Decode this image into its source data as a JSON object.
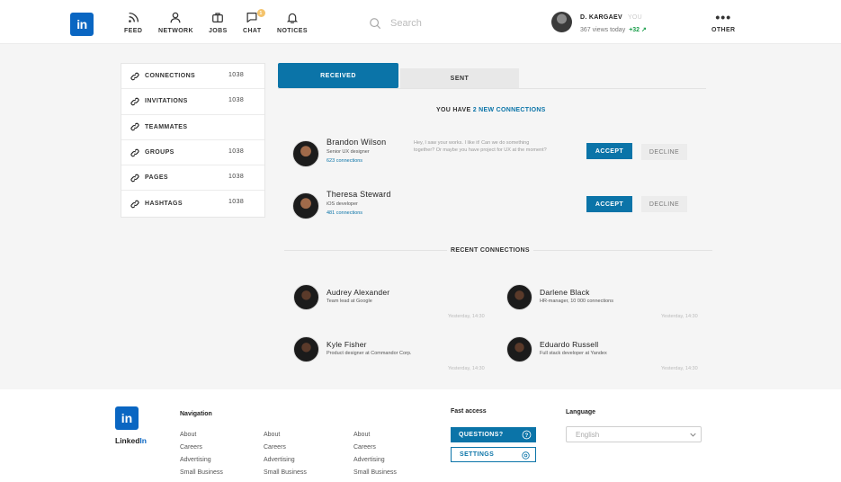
{
  "header": {
    "logo": "in",
    "nav": [
      {
        "label": "FEED",
        "icon": "rss-icon"
      },
      {
        "label": "NETWORK",
        "icon": "user-icon"
      },
      {
        "label": "JOBS",
        "icon": "briefcase-icon"
      },
      {
        "label": "CHAT",
        "icon": "chat-icon",
        "badge": "1"
      },
      {
        "label": "NOTICES",
        "icon": "bell-icon"
      }
    ],
    "search_placeholder": "Search",
    "user": {
      "name": "D. KARGAEV",
      "you": "YOU",
      "views": "367 views today",
      "delta": "+32 ↗"
    },
    "other_label": "OTHER"
  },
  "sidebar": {
    "items": [
      {
        "label": "CONNECTIONS",
        "count": "1038"
      },
      {
        "label": "INVITATIONS",
        "count": "1038"
      },
      {
        "label": "TEAMMATES",
        "count": ""
      },
      {
        "label": "GROUPS",
        "count": "1038"
      },
      {
        "label": "PAGES",
        "count": "1038"
      },
      {
        "label": "HASHTAGS",
        "count": "1038"
      }
    ]
  },
  "tabs": {
    "received": "RECEIVED",
    "sent": "SENT"
  },
  "new_connections": {
    "prefix": "YOU HAVE",
    "highlight": "2 NEW CONNECTIONS"
  },
  "requests": [
    {
      "name": "Brandon Wilson",
      "role": "Senior UX designer",
      "connections": "623 connections",
      "message": "Hey, I saw your works. I like it! Can we do something together? Or maybe you have project for UX at the moment?"
    },
    {
      "name": "Theresa Steward",
      "role": "iOS developer",
      "connections": "481 connections",
      "message": ""
    }
  ],
  "buttons": {
    "accept": "ACCEPT",
    "decline": "DECLINE"
  },
  "recent": {
    "title": "RECENT CONNECTIONS",
    "items": [
      {
        "name": "Audrey Alexander",
        "role": "Team lead at Google",
        "time": "Yesterday, 14:30"
      },
      {
        "name": "Darlene Black",
        "role": "HR-manager, 10 000 connections",
        "time": "Yesterday, 14:30"
      },
      {
        "name": "Kyle Fisher",
        "role": "Product designer at Commandor Corp.",
        "time": "Yesterday, 14:30"
      },
      {
        "name": "Eduardo Russell",
        "role": "Full stack developer at Yandex",
        "time": "Yesterday, 14:30"
      }
    ]
  },
  "footer": {
    "brand_a": "Linked",
    "brand_b": "In",
    "navigation_title": "Navigation",
    "columns": [
      [
        "About",
        "Careers",
        "Advertising",
        "Small Business"
      ],
      [
        "About",
        "Careers",
        "Advertising",
        "Small Business"
      ],
      [
        "About",
        "Careers",
        "Advertising",
        "Small Business"
      ]
    ],
    "fast_access_title": "Fast access",
    "questions_label": "QUESTIONS?",
    "settings_label": "SETTINGS",
    "language_title": "Language",
    "language_value": "English"
  },
  "colors": {
    "accent": "#0b74a8",
    "brand": "#0a66c2",
    "positive": "#1a9e4b"
  }
}
